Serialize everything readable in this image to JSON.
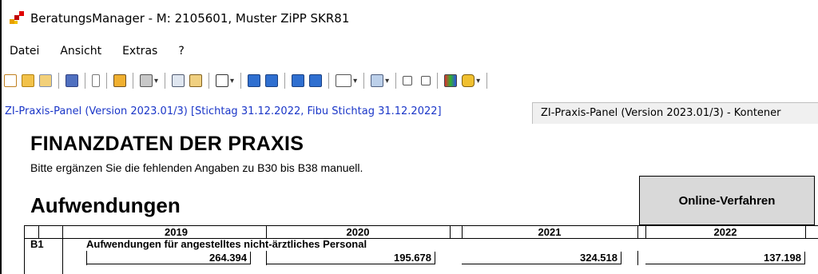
{
  "window": {
    "title": "BeratungsManager - M: 2105601, Muster ZiPP SKR81"
  },
  "menu": [
    "Datei",
    "Ansicht",
    "Extras",
    "?"
  ],
  "tabs": [
    {
      "label": "ZI-Praxis-Panel (Version 2023.01/3) [Stichtag 31.12.2022, Fibu Stichtag 31.12.2022]",
      "active": true
    },
    {
      "label": "ZI-Praxis-Panel (Version 2023.01/3) - Kontener",
      "active": false
    }
  ],
  "content": {
    "heading": "FINANZDATEN DER PRAXIS",
    "subtitle": "Bitte ergänzen Sie die fehlenden Angaben zu B30 bis B38 manuell.",
    "section": "Aufwendungen",
    "online_button": "Online-Verfahren",
    "years": [
      "2019",
      "2020",
      "2021",
      "2022"
    ],
    "row_b1": {
      "code": "B1",
      "label": "Aufwendungen für angestelltes nicht-ärztliches Personal",
      "values": [
        "264.394",
        "195.678",
        "324.518",
        "137.198"
      ]
    }
  },
  "colors": {
    "tab_active_text": "#1a36c8",
    "online_bg": "#d9d9d9"
  }
}
